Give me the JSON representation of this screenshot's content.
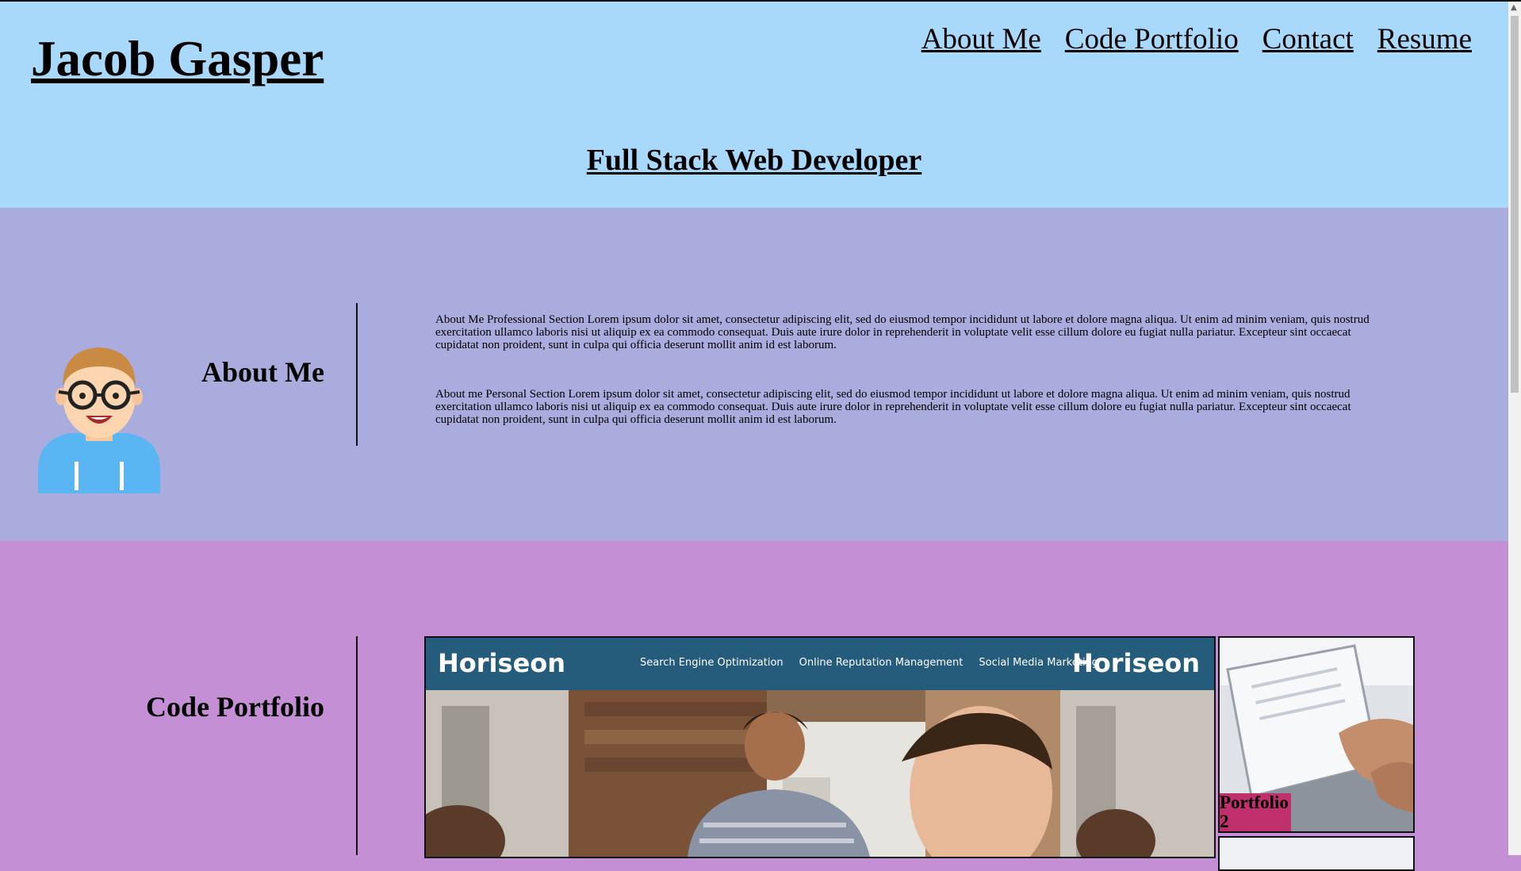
{
  "header": {
    "site_title": "Jacob Gasper",
    "subtitle": "Full Stack Web Developer",
    "nav": [
      {
        "label": "About Me"
      },
      {
        "label": "Code Portfolio"
      },
      {
        "label": "Contact"
      },
      {
        "label": "Resume"
      }
    ]
  },
  "about": {
    "heading": "About Me",
    "paragraphs": [
      "About Me Professional Section Lorem ipsum dolor sit amet, consectetur adipiscing elit, sed do eiusmod tempor incididunt ut labore et dolore magna aliqua. Ut enim ad minim veniam, quis nostrud exercitation ullamco laboris nisi ut aliquip ex ea commodo consequat. Duis aute irure dolor in reprehenderit in voluptate velit esse cillum dolore eu fugiat nulla pariatur. Excepteur sint occaecat cupidatat non proident, sunt in culpa qui officia deserunt mollit anim id est laborum.",
      "About me Personal Section Lorem ipsum dolor sit amet, consectetur adipiscing elit, sed do eiusmod tempor incididunt ut labore et dolore magna aliqua. Ut enim ad minim veniam, quis nostrud exercitation ullamco laboris nisi ut aliquip ex ea commodo consequat. Duis aute irure dolor in reprehenderit in voluptate velit esse cillum dolore eu fugiat nulla pariatur. Excepteur sint occaecat cupidatat non proident, sunt in culpa qui officia deserunt mollit anim id est laborum."
    ]
  },
  "portfolio": {
    "heading": "Code Portfolio",
    "main_project": {
      "logo": "Horiseon",
      "logo_repeat": "Horiseon",
      "links": [
        "Search Engine Optimization",
        "Online Reputation Management",
        "Social Media Marketing"
      ]
    },
    "side_project": {
      "label": "Portfolio 2"
    }
  },
  "colors": {
    "header_bg": "#a8d8fa",
    "about_bg": "#aaacdd",
    "portfolio_bg": "#c48fd4",
    "horiseon_bar": "#255c7c",
    "label_bg": "#c0306c"
  },
  "icons": {
    "avatar": "developer-avatar-icon"
  }
}
